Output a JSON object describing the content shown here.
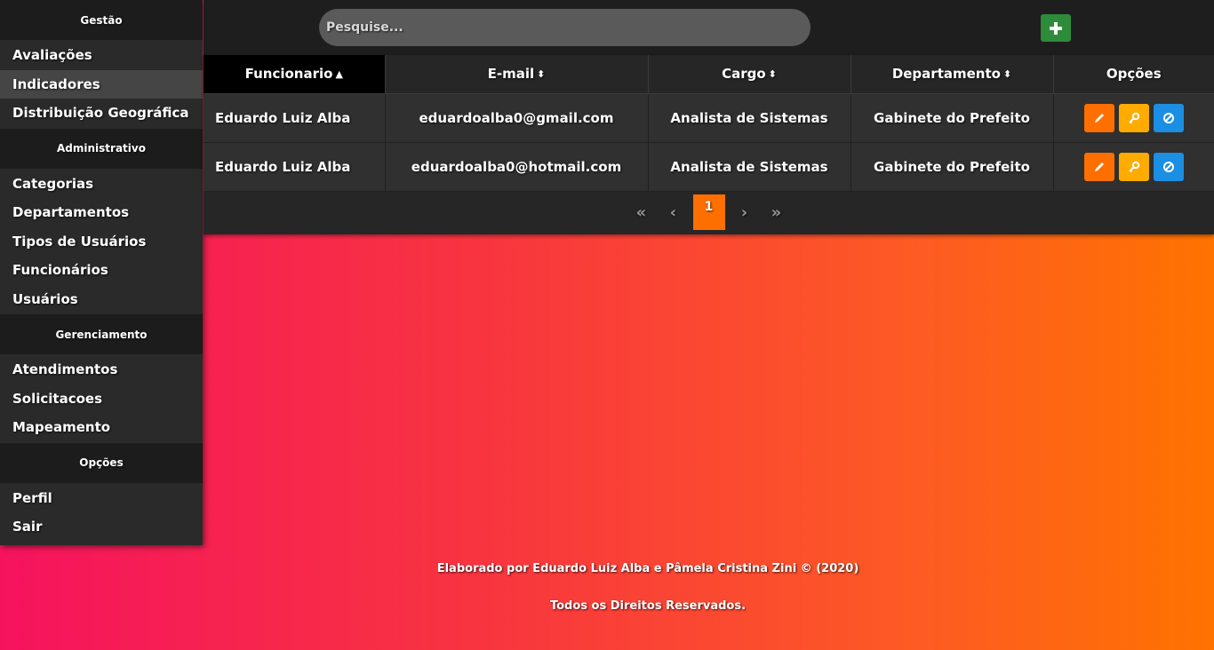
{
  "sidebar": {
    "sections": [
      {
        "title": "Gestão",
        "items": [
          "Avaliações",
          "Indicadores",
          "Distribuição Geográfica"
        ]
      },
      {
        "title": "Administrativo",
        "items": [
          "Categorias",
          "Departamentos",
          "Tipos de Usuários",
          "Funcionários",
          "Usuários"
        ]
      },
      {
        "title": "Gerenciamento",
        "items": [
          "Atendimentos",
          "Solicitacoes",
          "Mapeamento"
        ]
      },
      {
        "title": "Opções",
        "items": [
          "Perfil",
          "Sair"
        ]
      }
    ],
    "active_item": "Indicadores"
  },
  "search": {
    "placeholder": "Pesquise..."
  },
  "toolbar": {
    "add_icon": "plus-icon",
    "add_color": "#2e8b3a"
  },
  "table": {
    "columns": [
      "Funcionario",
      "E-mail",
      "Cargo",
      "Departamento",
      "Opções"
    ],
    "sorted_column": "Funcionario",
    "rows": [
      {
        "name": "Eduardo Luiz Alba",
        "email": "eduardoalba0@gmail.com",
        "cargo": "Analista de Sistemas",
        "departamento": "Gabinete do Prefeito"
      },
      {
        "name": "Eduardo Luiz Alba",
        "email": "eduardoalba0@hotmail.com",
        "cargo": "Analista de Sistemas",
        "departamento": "Gabinete do Prefeito"
      }
    ],
    "actions": [
      {
        "icon": "pencil-icon",
        "color": "#ff6f00"
      },
      {
        "icon": "key-icon",
        "color": "#ffab00"
      },
      {
        "icon": "block-icon",
        "color": "#1a8fe3"
      }
    ]
  },
  "pagination": {
    "first": "«",
    "prev": "‹",
    "current": "1",
    "next": "›",
    "last": "»"
  },
  "footer": {
    "line1": "Elaborado por Eduardo Luiz Alba e Pâmela Cristina Zini © (2020)",
    "line2": "Todos os Direitos Reservados."
  }
}
